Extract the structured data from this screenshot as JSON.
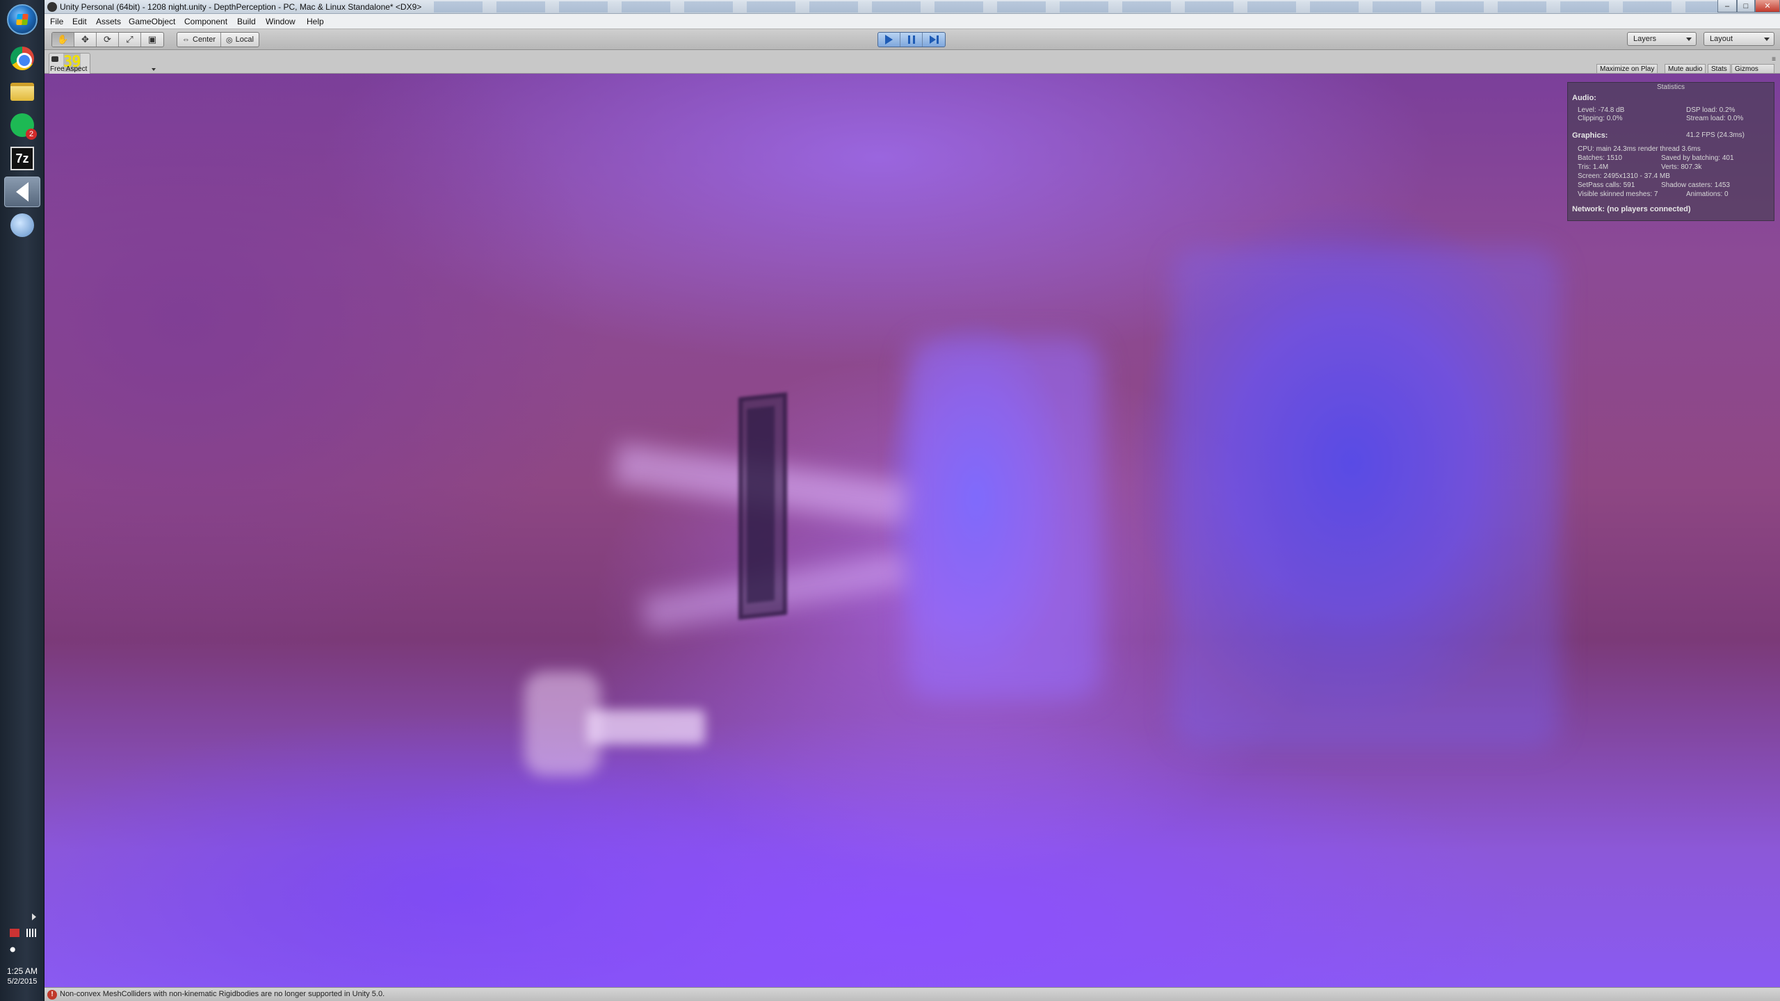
{
  "window": {
    "title": "Unity Personal (64bit) - 1208 night.unity - DepthPerception - PC, Mac & Linux Standalone* <DX9>",
    "controls": {
      "minimize": "–",
      "maximize": "□",
      "close": "✕"
    }
  },
  "menubar": {
    "items": [
      "File",
      "Edit",
      "Assets",
      "GameObject",
      "Component",
      "Build",
      "Window",
      "Help"
    ]
  },
  "toolbar": {
    "tools": [
      "hand-tool",
      "move-tool",
      "rotate-tool",
      "scale-tool",
      "rect-tool"
    ],
    "pivot": {
      "center_label": "Center",
      "local_label": "Local"
    },
    "layers_label": "Layers",
    "layout_label": "Layout"
  },
  "game_view": {
    "aspect_label": "Free Aspect",
    "fps_counter": "39",
    "toggles": {
      "maximize": "Maximize on Play",
      "mute": "Mute audio",
      "stats": "Stats",
      "gizmos": "Gizmos"
    }
  },
  "stats": {
    "title": "Statistics",
    "audio_header": "Audio:",
    "level": "Level: -74.8 dB",
    "dsp_load": "DSP load: 0.2%",
    "clipping": "Clipping: 0.0%",
    "stream_load": "Stream load: 0.0%",
    "graphics_header": "Graphics:",
    "fps": "41.2 FPS (24.3ms)",
    "cpu": "CPU: main 24.3ms  render thread 3.6ms",
    "batches": "Batches: 1510",
    "saved_batching": "Saved by batching: 401",
    "tris": "Tris: 1.4M",
    "verts": "Verts: 807.3k",
    "screen": "Screen: 2495x1310 - 37.4 MB",
    "setpass": "SetPass calls: 591",
    "shadow_casters": "Shadow casters: 1453",
    "skinned_meshes": "Visible skinned meshes: 7",
    "animations": "Animations: 0",
    "network": "Network: (no players connected)"
  },
  "statusbar": {
    "message": "Non-convex MeshColliders with non-kinematic Rigidbodies are no longer supported in Unity 5.0."
  },
  "taskbar": {
    "time": "1:25 AM",
    "date": "5/2/2015",
    "apps": [
      "chrome-icon",
      "file-explorer-icon",
      "spotify-icon",
      "7zip-icon",
      "unity-icon",
      "globe-icon"
    ],
    "spotify_badge": "2"
  },
  "colors": {
    "play_accent": "#1e5bb5",
    "viewport_tint": "#8a5af2",
    "fps_overlay": "#f0e000",
    "error": "#c0392b"
  }
}
